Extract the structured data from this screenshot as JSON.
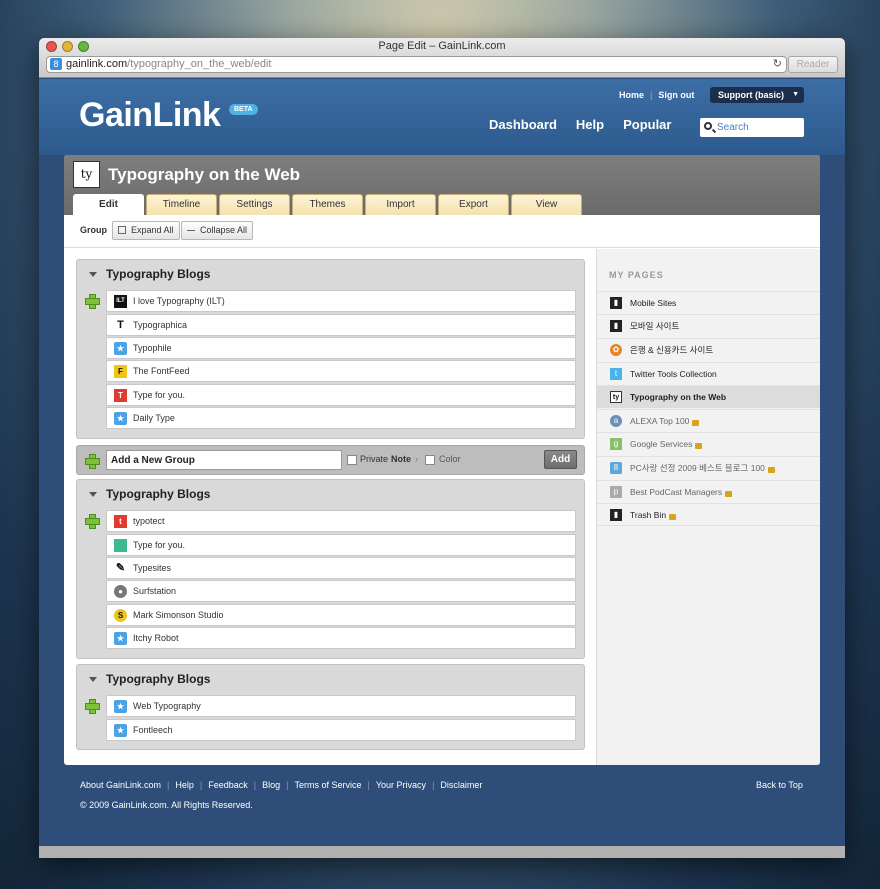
{
  "window": {
    "title": "Page Edit – GainLink.com",
    "url_host": "gainlink.com",
    "url_path": "/typography_on_the_web/edit",
    "reader_label": "Reader",
    "reload_icon": "↻"
  },
  "header": {
    "logo": "GainLink",
    "beta": "BETA",
    "top_links": [
      "Home",
      "Sign out"
    ],
    "support_label": "Support (basic)",
    "nav": [
      "Dashboard",
      "Help",
      "Popular"
    ],
    "search_placeholder": "Search"
  },
  "page": {
    "logo_text": "ty",
    "title": "Typography on the Web",
    "tabs": [
      "Edit",
      "Timeline",
      "Settings",
      "Themes",
      "Import",
      "Export",
      "View"
    ],
    "toolbar": {
      "group_label": "Group",
      "expand": "Expand All",
      "collapse": "Collapse All"
    }
  },
  "groups": [
    {
      "title": "Typography Blogs",
      "items": [
        {
          "label": "I love Typography (ILT)",
          "icon": "ILT"
        },
        {
          "label": "Typographica",
          "icon": "T"
        },
        {
          "label": "Typophile",
          "icon": "★"
        },
        {
          "label": "The FontFeed",
          "icon": "F"
        },
        {
          "label": "Type for you.",
          "icon": "T"
        },
        {
          "label": "Daily Type",
          "icon": "★"
        }
      ]
    },
    {
      "title": "Typography Blogs",
      "items": [
        {
          "label": "typotect",
          "icon": "t"
        },
        {
          "label": "Type for you.",
          "icon": ""
        },
        {
          "label": "Typesites",
          "icon": "✎"
        },
        {
          "label": "Surfstation",
          "icon": "●"
        },
        {
          "label": "Mark Simonson Studio",
          "icon": "S"
        },
        {
          "label": "Itchy Robot",
          "icon": "★"
        }
      ]
    },
    {
      "title": "Typography Blogs",
      "items": [
        {
          "label": "Web Typography",
          "icon": "★"
        },
        {
          "label": "Fontleech",
          "icon": "★"
        }
      ]
    }
  ],
  "add_group": {
    "value": "Add a New Group",
    "private": "Private",
    "note": "Note",
    "note_arrow": "›",
    "color": "Color",
    "add": "Add"
  },
  "sidebar": {
    "title": "MY PAGES",
    "items": [
      {
        "label": "Mobile Sites",
        "icon": "▮"
      },
      {
        "label": "모바일 사이트",
        "icon": "▮"
      },
      {
        "label": "은행 & 신용카드 사이트",
        "icon": "✿"
      },
      {
        "label": "Twitter Tools Collection",
        "icon": "t"
      },
      {
        "label": "Typography on the Web",
        "icon": "ty"
      },
      {
        "label": "ALEXA Top 100",
        "icon": "a"
      },
      {
        "label": "Google Services",
        "icon": "g"
      },
      {
        "label": "PC사랑 선정 2009 베스트 블로그 100",
        "icon": "8"
      },
      {
        "label": "Best PodCast Managers",
        "icon": "p"
      },
      {
        "label": "Trash Bin",
        "icon": "▮"
      }
    ]
  },
  "footer": {
    "links": [
      "About GainLink.com",
      "Help",
      "Feedback",
      "Blog",
      "Terms of Service",
      "Your Privacy",
      "Disclaimer"
    ],
    "back_to_top": "Back to Top",
    "copyright": "© 2009 GainLink.com. All Rights Reserved."
  }
}
